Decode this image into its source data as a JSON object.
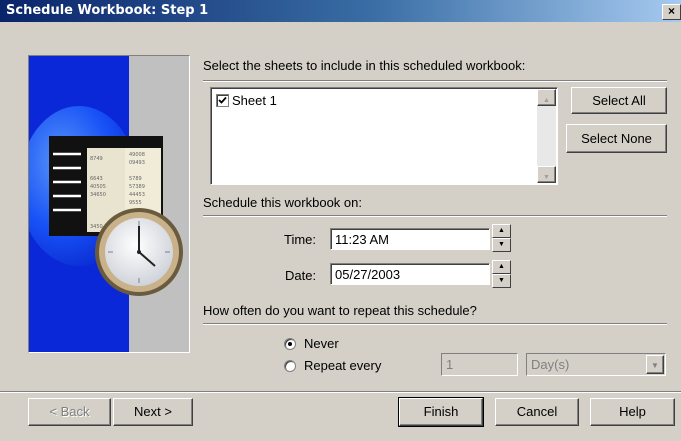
{
  "window": {
    "title": "Schedule Workbook: Step 1",
    "close_glyph": "×"
  },
  "sheets": {
    "heading": "Select the sheets to include in this scheduled workbook:",
    "items": [
      {
        "label": "Sheet 1",
        "checked": true
      }
    ],
    "select_all_label": "Select All",
    "select_none_label": "Select None"
  },
  "schedule": {
    "heading": "Schedule this workbook on:",
    "time_label": "Time:",
    "time_value": "11:23 AM",
    "date_label": "Date:",
    "date_value": "05/27/2003"
  },
  "repeat": {
    "heading": "How often do you want to repeat this schedule?",
    "never_label": "Never",
    "repeat_every_label": "Repeat every",
    "interval_value": "1",
    "unit_value": "Day(s)",
    "selected": "never"
  },
  "illustration": {
    "sheet_numbers_left": [
      "8749",
      "6643",
      "40505",
      "34650",
      "3450"
    ],
    "sheet_numbers_right": [
      "49008",
      "09493",
      "5789",
      "57389",
      "44453",
      "9555"
    ]
  },
  "buttons": {
    "back_label": "< Back",
    "next_label": "Next >",
    "finish_label": "Finish",
    "cancel_label": "Cancel",
    "help_label": "Help"
  }
}
